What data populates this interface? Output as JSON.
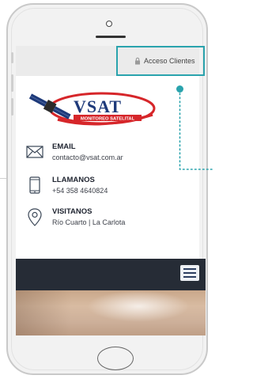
{
  "header": {
    "access_label": "Acceso Clientes",
    "access_icon": "lock-icon"
  },
  "logo": {
    "brand": "VSAT",
    "tagline": "MONITOREO SATELITAL"
  },
  "contacts": [
    {
      "label": "EMAIL",
      "value": "contacto@vsat.com.ar",
      "icon": "envelope-icon"
    },
    {
      "label": "LLAMANOS",
      "value": "+54 358 4640824",
      "icon": "phone-icon"
    },
    {
      "label": "VISITANOS",
      "value": "Río Cuarto | La Carlota",
      "icon": "map-pin-icon"
    }
  ],
  "nav": {
    "menu_icon": "hamburger-menu-icon"
  },
  "colors": {
    "accent": "#2aa3ad",
    "nav_bg": "#262c36",
    "logo_red": "#d6262a",
    "logo_blue": "#1e3a7a"
  }
}
